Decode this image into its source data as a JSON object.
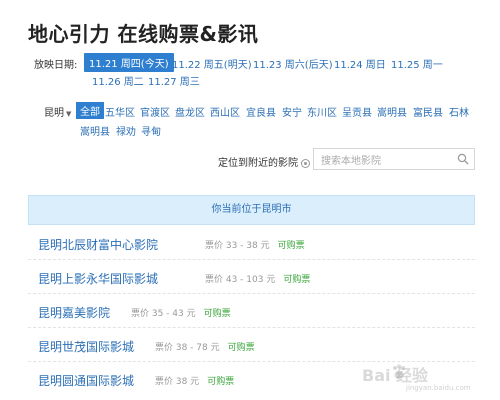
{
  "page": {
    "title": "地心引力 在线购票&影讯"
  },
  "dates": {
    "label": "放映日期:",
    "options": [
      "11.21 周四(今天)",
      "11.22 周五(明天)",
      "11.23 周六(后天)",
      "11.24 周日",
      "11.25 周一",
      "11.26 周二",
      "11.27 周三"
    ],
    "selected_index": 0
  },
  "districts": {
    "city": "昆明",
    "items": [
      "全部",
      "五华区",
      "官渡区",
      "盘龙区",
      "西山区",
      "宜良县",
      "安宁",
      "东川区",
      "呈贡县",
      "嵩明县",
      "富民县",
      "石林",
      "嵩明县",
      "禄劝",
      "寻甸"
    ],
    "selected_index": 0
  },
  "locate": {
    "label": "定位到附近的影院"
  },
  "search": {
    "placeholder": "搜索本地影院",
    "value": ""
  },
  "banner": {
    "text": "你当前位于昆明市"
  },
  "cinemas": [
    {
      "name": "昆明北辰财富中心影院",
      "price": "票价 33 - 38 元",
      "status": "可购票"
    },
    {
      "name": "昆明上影永华国际影城",
      "price": "票价 43 - 103 元",
      "status": "可购票"
    },
    {
      "name": "昆明嘉美影院",
      "price": "票价 35 - 43 元",
      "status": "可购票"
    },
    {
      "name": "昆明世茂国际影城",
      "price": "票价 38 - 78 元",
      "status": "可购票"
    },
    {
      "name": "昆明圆通国际影城",
      "price": "票价 38 元",
      "status": "可购票"
    }
  ],
  "watermark": {
    "text": "Bai  经验",
    "url": "jingyan.baidu.com"
  },
  "colors": {
    "accent": "#2e7fcf",
    "link": "#2b6fb6",
    "buyable": "#3aa53a",
    "banner_bg": "#dbeefb"
  }
}
